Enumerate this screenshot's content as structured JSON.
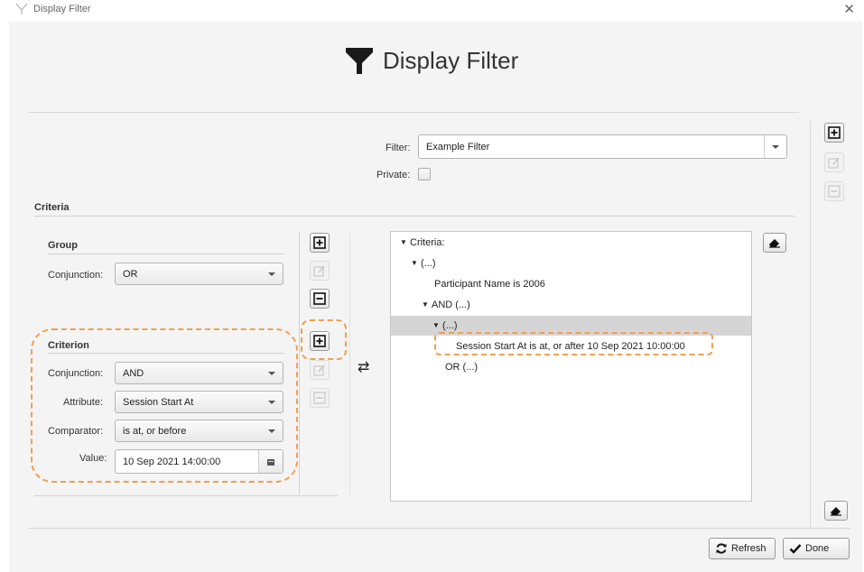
{
  "window": {
    "title": "Display Filter",
    "close_glyph": "✕"
  },
  "header": {
    "title": "Display Filter",
    "icon": "filter-icon"
  },
  "filter": {
    "label": "Filter:",
    "value": "Example Filter",
    "private_label": "Private:",
    "private_checked": false
  },
  "criteria": {
    "section_title": "Criteria"
  },
  "group": {
    "title": "Group",
    "conjunction_label": "Conjunction:",
    "conjunction_value": "OR"
  },
  "criterion": {
    "title": "Criterion",
    "conjunction_label": "Conjunction:",
    "conjunction_value": "AND",
    "attribute_label": "Attribute:",
    "attribute_value": "Session Start At",
    "comparator_label": "Comparator:",
    "comparator_value": "is at, or before",
    "value_label": "Value:",
    "value_value": "10 Sep 2021 14:00:00"
  },
  "tree": {
    "rows": [
      {
        "text": "Criteria:",
        "arrow": "▼",
        "indent": 0,
        "selected": false
      },
      {
        "text": "(...)",
        "arrow": "▼",
        "indent": 1,
        "selected": false
      },
      {
        "text": "Participant Name is 2006",
        "arrow": "",
        "indent": 2,
        "selected": false
      },
      {
        "text": "AND (...)",
        "arrow": "▼",
        "indent": 2,
        "selected": false
      },
      {
        "text": "(...)",
        "arrow": "▼",
        "indent": 3,
        "selected": true
      },
      {
        "text": "Session Start At is at, or after 10 Sep 2021 10:00:00",
        "arrow": "",
        "indent": 4,
        "selected": false
      },
      {
        "text": "OR (...)",
        "arrow": "",
        "indent": 3,
        "selected": false
      }
    ]
  },
  "swap_glyph": "⇄",
  "footer": {
    "refresh_label": "Refresh",
    "done_label": "Done"
  },
  "colors": {
    "highlight": "#f0a050",
    "selection": "#d5d5d5"
  }
}
